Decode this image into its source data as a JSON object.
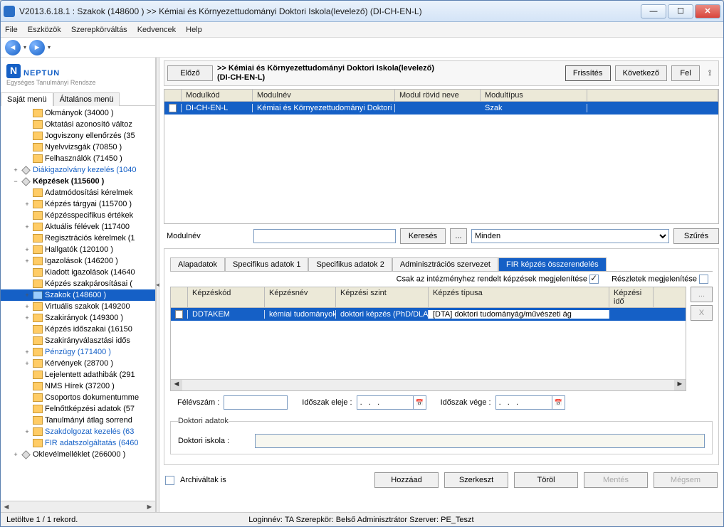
{
  "window": {
    "title": "V2013.6.18.1 : Szakok (148600  )  >> Kémiai és Környezettudományi Doktori Iskola(levelező) (DI-CH-EN-L)"
  },
  "menubar": [
    "File",
    "Eszközök",
    "Szerepkörváltás",
    "Kedvencek",
    "Help"
  ],
  "logo": {
    "text": "NEPTUN",
    "sub": "Egységes Tanulmányi Rendsze"
  },
  "left_tabs": {
    "own": "Saját menü",
    "general": "Általános menü"
  },
  "tree": [
    {
      "ind": 2,
      "icon": "y",
      "exp": "",
      "label": "Okmányok (34000  )"
    },
    {
      "ind": 2,
      "icon": "y",
      "exp": "",
      "label": "Oktatási azonosító változ"
    },
    {
      "ind": 2,
      "icon": "y",
      "exp": "",
      "label": "Jogviszony ellenőrzés (35"
    },
    {
      "ind": 2,
      "icon": "y",
      "exp": "",
      "label": "Nyelvvizsgák (70850  )"
    },
    {
      "ind": 2,
      "icon": "y",
      "exp": "",
      "label": "Felhasználók (71450  )"
    },
    {
      "ind": 1,
      "icon": "d",
      "exp": "+",
      "label": "Diákigazolvány kezelés (1040",
      "link": true
    },
    {
      "ind": 1,
      "icon": "d",
      "exp": "−",
      "label": "Képzések (115600  )",
      "bold": true
    },
    {
      "ind": 2,
      "icon": "y",
      "exp": "",
      "label": "Adatmódosítási kérelmek"
    },
    {
      "ind": 2,
      "icon": "y",
      "exp": "+",
      "label": "Képzés tárgyai (115700  )"
    },
    {
      "ind": 2,
      "icon": "y",
      "exp": "",
      "label": "Képzésspecifikus értékek"
    },
    {
      "ind": 2,
      "icon": "y",
      "exp": "+",
      "label": "Aktuális félévek (117400"
    },
    {
      "ind": 2,
      "icon": "y",
      "exp": "",
      "label": "Regisztrációs kérelmek (1"
    },
    {
      "ind": 2,
      "icon": "y",
      "exp": "+",
      "label": "Hallgatók (120100  )"
    },
    {
      "ind": 2,
      "icon": "y",
      "exp": "+",
      "label": "Igazolások (146200  )"
    },
    {
      "ind": 2,
      "icon": "y",
      "exp": "",
      "label": "Kiadott igazolások (14640"
    },
    {
      "ind": 2,
      "icon": "y",
      "exp": "",
      "label": "Képzés szakpárosításai ("
    },
    {
      "ind": 2,
      "icon": "b",
      "exp": "+",
      "label": "Szakok (148600  )",
      "selected": true
    },
    {
      "ind": 2,
      "icon": "y",
      "exp": "+",
      "label": "Virtuális szakok (149200"
    },
    {
      "ind": 2,
      "icon": "y",
      "exp": "+",
      "label": "Szakirányok (149300  )"
    },
    {
      "ind": 2,
      "icon": "y",
      "exp": "",
      "label": "Képzés időszakai (16150"
    },
    {
      "ind": 2,
      "icon": "y",
      "exp": "",
      "label": "Szakirányválasztási idős"
    },
    {
      "ind": 2,
      "icon": "y",
      "exp": "+",
      "label": "Pénzügy (171400  )",
      "link": true
    },
    {
      "ind": 2,
      "icon": "y",
      "exp": "+",
      "label": "Kérvények (28700  )"
    },
    {
      "ind": 2,
      "icon": "y",
      "exp": "",
      "label": "Lejelentett adathibák (291"
    },
    {
      "ind": 2,
      "icon": "y",
      "exp": "",
      "label": "NMS Hírek (37200  )"
    },
    {
      "ind": 2,
      "icon": "y",
      "exp": "",
      "label": "Csoportos dokumentumme"
    },
    {
      "ind": 2,
      "icon": "y",
      "exp": "",
      "label": "Felnőttképzési adatok (57"
    },
    {
      "ind": 2,
      "icon": "y",
      "exp": "",
      "label": "Tanulmányi átlag sorrend"
    },
    {
      "ind": 2,
      "icon": "y",
      "exp": "+",
      "label": "Szakdolgozat kezelés (63",
      "link": true
    },
    {
      "ind": 2,
      "icon": "y",
      "exp": "",
      "label": "FIR adatszolgáltatás (6460",
      "link": true
    },
    {
      "ind": 1,
      "icon": "d",
      "exp": "+",
      "label": "Oklevélmelléklet (266000  )"
    }
  ],
  "rp_header": {
    "prev": "Előző",
    "title_line1": ">> Kémiai és Környezettudományi Doktori Iskola(levelező)",
    "title_line2": "(DI-CH-EN-L)",
    "refresh": "Frissítés",
    "next": "Következő",
    "up": "Fel"
  },
  "topgrid": {
    "headers": {
      "code": "Modulkód",
      "name": "Modulnév",
      "short": "Modul rövid neve",
      "type": "Modultípus"
    },
    "row": {
      "code": "DI-CH-EN-L",
      "name": "Kémiai és Környezettudományi Doktori Is",
      "short": "",
      "type": "Szak"
    }
  },
  "search": {
    "label": "Modulnév",
    "value": "",
    "button": "Keresés",
    "ellipsis": "...",
    "dropdown": "Minden",
    "filter": "Szűrés"
  },
  "subtabs": [
    "Alapadatok",
    "Specifikus adatok 1",
    "Specifikus adatok 2",
    "Adminisztrációs szervezet",
    "FIR képzés összerendelés"
  ],
  "subtab_active": 4,
  "filters": {
    "inst_only": "Csak az intézményhez rendelt képzések megjelenítése",
    "inst_only_checked": true,
    "details": "Részletek megjelenítése",
    "details_checked": false
  },
  "subgrid": {
    "headers": {
      "code": "Képzéskód",
      "name": "Képzésnév",
      "level": "Képzési szint",
      "type": "Képzés típusa",
      "time": "Képzési idő"
    },
    "row": {
      "code": "DDTAKEM",
      "name": "kémiai tudományok",
      "level": "doktori képzés (PhD/DLA",
      "type": "[DTA] doktori tudományág/művészeti ág",
      "time": ""
    }
  },
  "sidebuttons": {
    "dots": "...",
    "x": "X"
  },
  "period": {
    "semester_label": "Félévszám :",
    "semester_value": "",
    "start_label": "Időszak eleje :",
    "start_value": ".   .   .",
    "end_label": "Időszak vége :",
    "end_value": ".   .   ."
  },
  "doctor_group": {
    "legend": "Doktori adatok",
    "school_label": "Doktori iskola :",
    "school_value": ""
  },
  "bottom": {
    "archived": "Archiváltak is",
    "archived_checked": false,
    "add": "Hozzáad",
    "edit": "Szerkeszt",
    "delete": "Töröl",
    "save": "Mentés",
    "cancel": "Mégsem"
  },
  "statusbar": {
    "records": "Letöltve 1 / 1 rekord.",
    "login": "Loginnév: TA   Szerepkör: Belső Adminisztrátor   Szerver: PE_Teszt"
  }
}
